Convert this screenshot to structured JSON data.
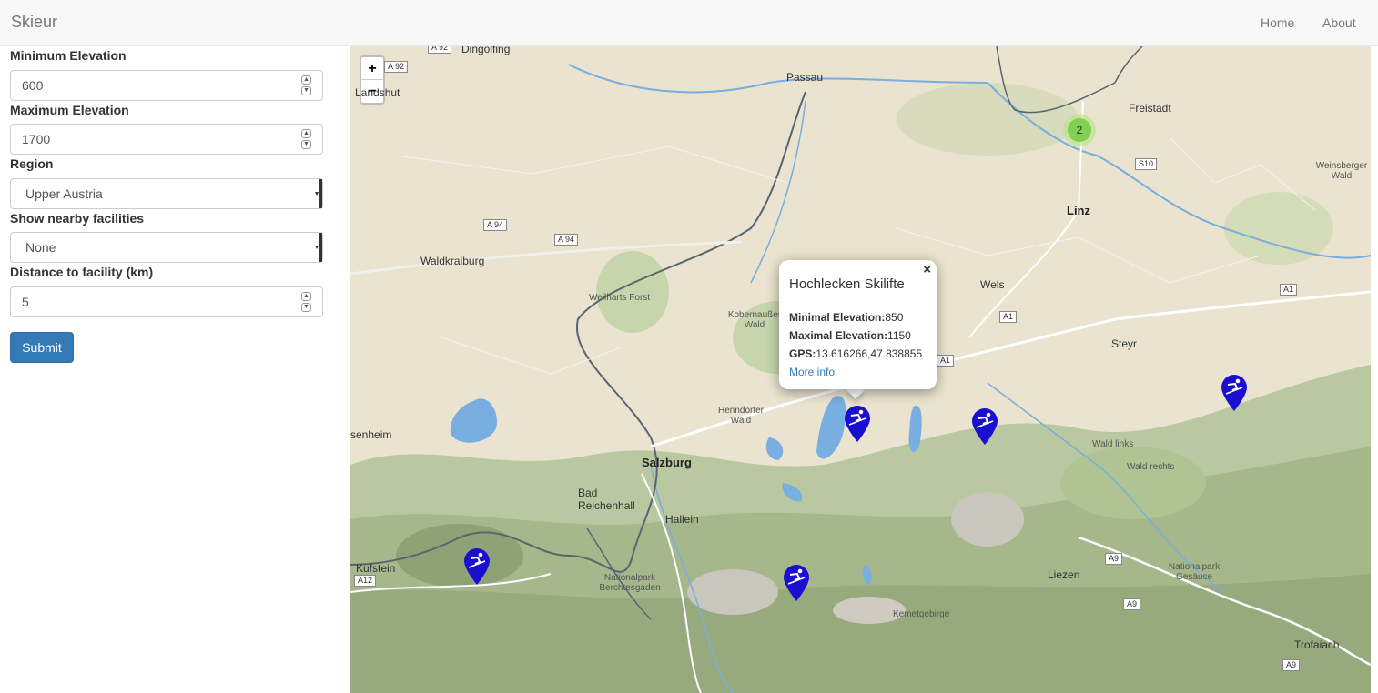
{
  "navbar": {
    "brand": "Skieur",
    "links": [
      "Home",
      "About"
    ]
  },
  "form": {
    "min_elevation_label": "Minimum Elevation",
    "min_elevation_value": "600",
    "max_elevation_label": "Maximum Elevation",
    "max_elevation_value": "1700",
    "region_label": "Region",
    "region_value": "Upper Austria",
    "facilities_label": "Show nearby facilities",
    "facilities_value": "None",
    "distance_label": "Distance to facility (km)",
    "distance_value": "5",
    "submit_label": "Submit"
  },
  "map": {
    "zoom_in": "+",
    "zoom_out": "−",
    "cluster_count": "2",
    "places": {
      "dingolfing": "Dingolfing",
      "passau": "Passau",
      "freistadt": "Freistadt",
      "linz": "Linz",
      "weinsberger_wald": "Weinsberger Wald",
      "waldkraiburg": "Waldkraiburg",
      "weilharts_forst": "Weilharts Forst",
      "kobernausser_wald": "Kobernaußer Wald",
      "wels": "Wels",
      "steyr": "Steyr",
      "henndorfer_wald": "Henndorfer Wald",
      "salzburg": "Salzburg",
      "senheim": "senheim",
      "bad_reichenhall": "Bad Reichenhall",
      "hallein": "Hallein",
      "wald_links": "Wald links",
      "wald_rechts": "Wald rechts",
      "kufstein": "Kufstein",
      "np_berchtesgaden": "Nationalpark Berchtesgaden",
      "liezen": "Liezen",
      "np_gesause": "Nationalpark Gesäuse",
      "kemetgebirge": "Kemetgebirge",
      "trofaiach": "Trofaiach",
      "landshut": "Landshut"
    },
    "roads": {
      "a92": "A 92",
      "s10": "S10",
      "a94a": "A 94",
      "a94b": "A 94",
      "a1a": "A1",
      "a1b": "A1",
      "a1c": "A1",
      "a12": "A12",
      "a9a": "A9",
      "a9b": "A9",
      "a9c": "A9"
    }
  },
  "popup": {
    "close": "×",
    "title": "Hochlecken Skilifte",
    "min_label": "Minimal Elevation:",
    "min_value": "850",
    "max_label": "Maximal Elevation:",
    "max_value": "1150",
    "gps_label": "GPS:",
    "gps_value": "13.616266,47.838855",
    "link": "More info"
  },
  "colors": {
    "marker": "#1a0fd1",
    "cluster": "#6ecc39",
    "primary": "#337ab7"
  }
}
